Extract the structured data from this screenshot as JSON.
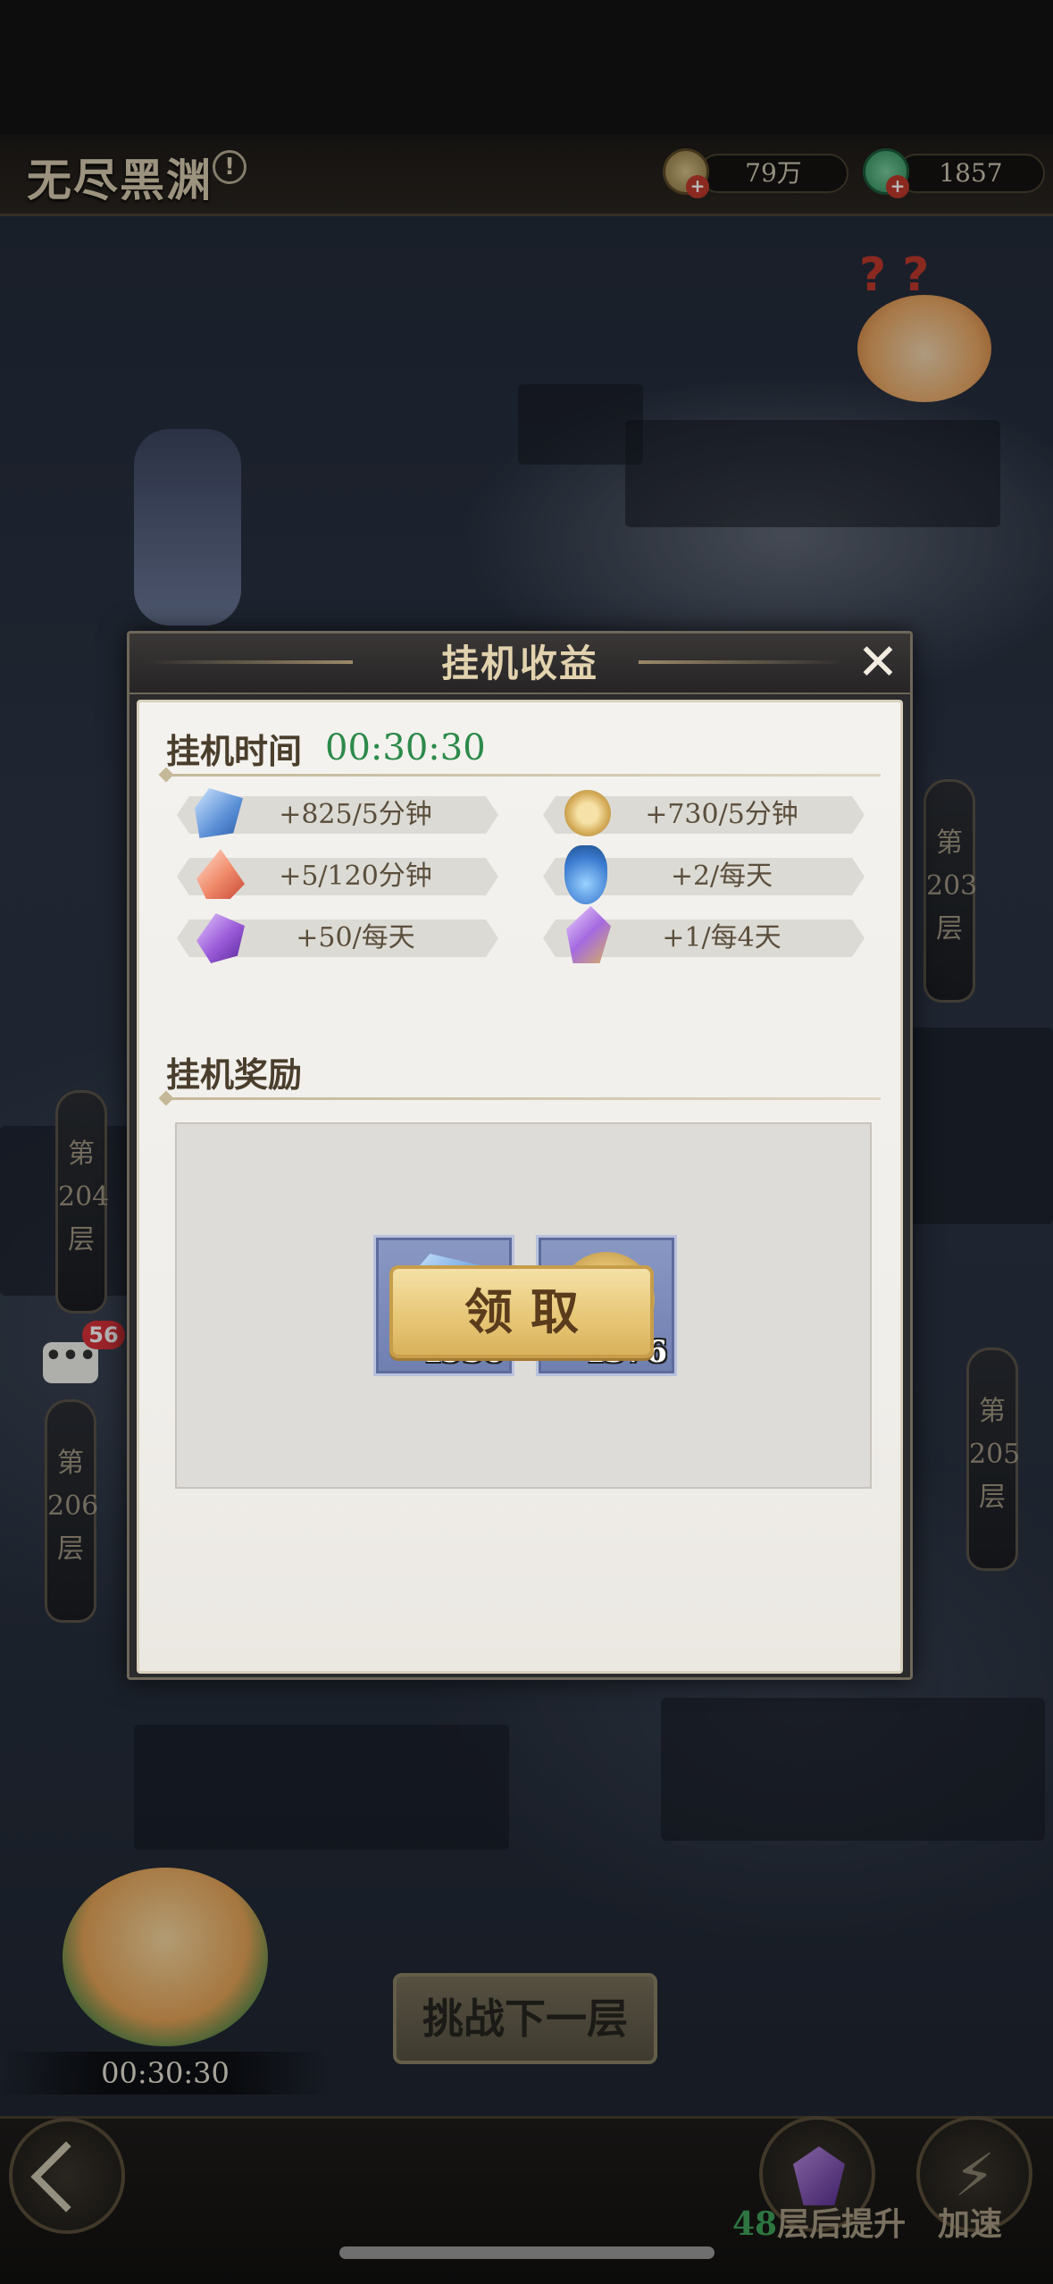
{
  "header": {
    "title": "无尽黑渊",
    "info_symbol": "!",
    "currency_coins": "79万",
    "currency_jade": "1857",
    "add_symbol": "+"
  },
  "floors": [
    {
      "char1": "第",
      "number": "203",
      "char2": "层"
    },
    {
      "char1": "第",
      "number": "204",
      "char2": "层"
    },
    {
      "char1": "第",
      "number": "205",
      "char2": "层"
    },
    {
      "char1": "第",
      "number": "206",
      "char2": "层"
    }
  ],
  "chat": {
    "symbol": "•••",
    "count": "56"
  },
  "dialog": {
    "title": "挂机收益",
    "close_symbol": "✕",
    "idle_label": "挂机时间",
    "idle_time": "00:30:30",
    "rates": [
      {
        "icon": "blue-crystal-icon",
        "text": "+825/5分钟"
      },
      {
        "icon": "gold-coin-icon",
        "text": "+730/5分钟"
      },
      {
        "icon": "red-crystal-icon",
        "text": "+5/120分钟"
      },
      {
        "icon": "blue-potion-icon",
        "text": "+2/每天"
      },
      {
        "icon": "purple-gem-icon",
        "text": "+50/每天"
      },
      {
        "icon": "purple-crystal-icon",
        "text": "+1/每4天"
      }
    ],
    "rewards_label": "挂机奖励",
    "rewards": [
      {
        "icon": "blue-crystal-icon",
        "count": "4950"
      },
      {
        "icon": "gold-coin-icon",
        "count": "4376"
      }
    ],
    "claim_label": "领取"
  },
  "bottom": {
    "challenge_label": "挑战下一层",
    "timer": "00:30:30",
    "upgrade_count": "48",
    "upgrade_suffix": "层后提升",
    "speed_label": "加速"
  },
  "colors": {
    "accent_green": "#2c8a4a",
    "claim_gold": "#e8c878",
    "badge_red": "#d9333a"
  }
}
